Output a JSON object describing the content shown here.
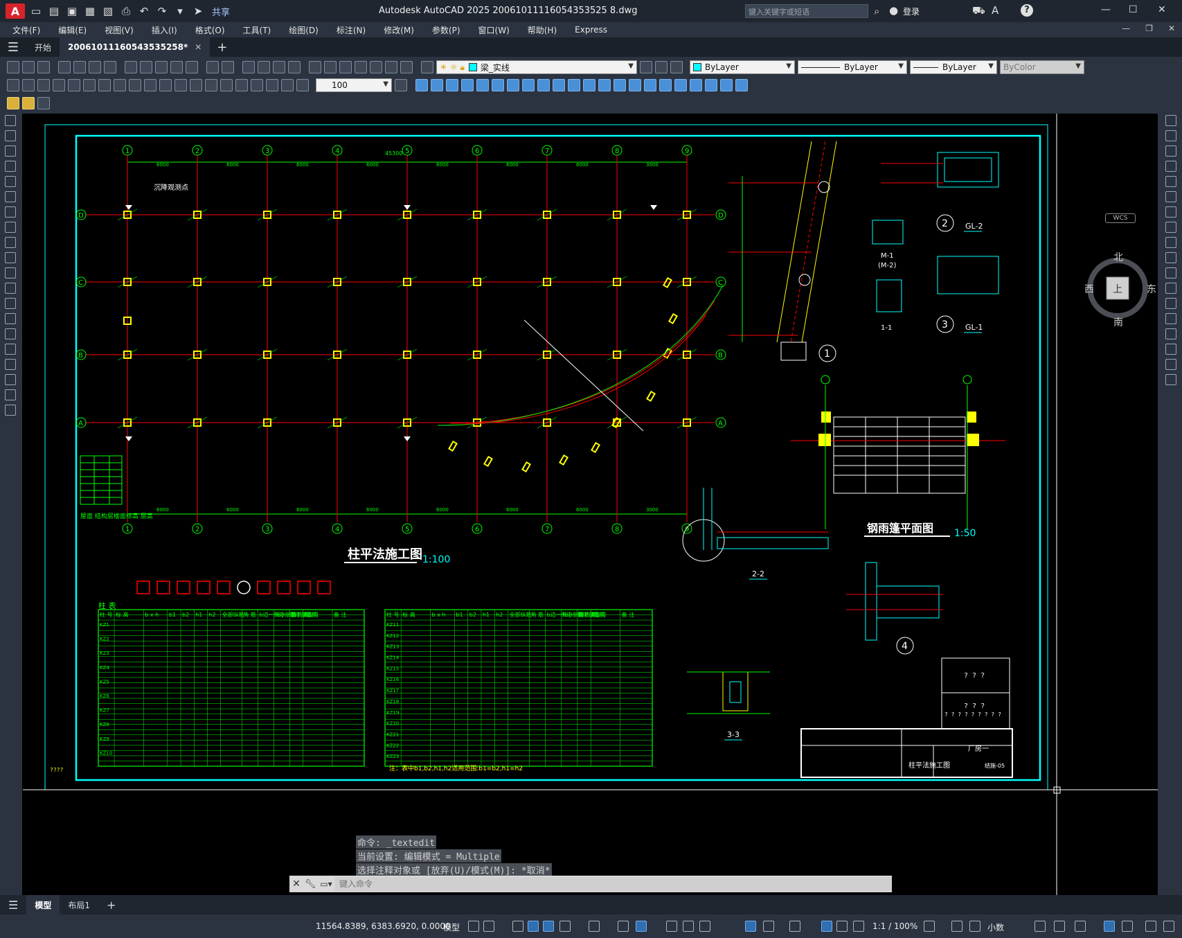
{
  "titlebar": {
    "app_logo": "A",
    "share_label": "共享",
    "title": "Autodesk AutoCAD 2025    20061011116054353525 8.dwg",
    "search_placeholder": "键入关键字或短语",
    "login_label": "登录"
  },
  "menu": [
    "文件(F)",
    "编辑(E)",
    "视图(V)",
    "插入(I)",
    "格式(O)",
    "工具(T)",
    "绘图(D)",
    "标注(N)",
    "修改(M)",
    "参数(P)",
    "窗口(W)",
    "帮助(H)",
    "Express"
  ],
  "tabs": {
    "start": "开始",
    "active_doc": "20061011160543535258*"
  },
  "toolbar2": {
    "layer_name": "梁_实线",
    "color_value": "ByLayer",
    "linetype_value": "ByLayer",
    "lineweight_value": "ByLayer",
    "plotstyle_value": "ByColor"
  },
  "toolbar3": {
    "dim_scale": "100"
  },
  "viewcube": {
    "north": "北",
    "south": "南",
    "east": "东",
    "west": "西",
    "top": "上",
    "wcs": "WCS"
  },
  "drawing": {
    "grid_cols": [
      "1",
      "2",
      "3",
      "4",
      "5",
      "6",
      "7",
      "8",
      "9"
    ],
    "grid_rows": [
      "D",
      "C",
      "B",
      "A"
    ],
    "top_dim_total": "45300",
    "bay_dims": [
      "6000",
      "6000",
      "6000",
      "6000",
      "6000",
      "6000",
      "6000",
      "3000"
    ],
    "main_title": "柱平法施工图",
    "main_scale": "1:100",
    "canopy_title": "钢雨篷平面图",
    "canopy_scale": "1:50",
    "section_2": "2-2",
    "section_3": "3-3",
    "section_1": "1-1",
    "gl2": "GL-2",
    "gl1": "GL-1",
    "m1": "M-1",
    "m2": "(M-2)",
    "settle_note": "沉降观测点",
    "table_heading": "柱 表",
    "table_headers": [
      "柱 号",
      "标 高",
      "b x h",
      "b1",
      "b2",
      "h1",
      "h2",
      "全部纵筋",
      "角 筋",
      "b边一侧中部筋",
      "h边一侧中部筋",
      "箍筋类型号",
      "箍 筋",
      "备 注"
    ],
    "table_left_ids": [
      "KZ1",
      "KZ2",
      "KZ3",
      "KZ4",
      "KZ5",
      "KZ6",
      "KZ7",
      "KZ8",
      "KZ9",
      "KZ10"
    ],
    "table_right_ids": [
      "KZ11",
      "KZ12",
      "KZ13",
      "KZ14",
      "KZ15",
      "KZ16",
      "KZ17",
      "KZ18",
      "KZ19",
      "KZ20",
      "KZ21",
      "KZ22",
      "KZ23"
    ],
    "footnote": "注：表中b1,b2,h1,h2适用范围:b1=b2,h1=h2",
    "titleblock_project": "厂房一",
    "titleblock_sheet": "柱平法施工图",
    "titleblock_no": "结施-05",
    "titleblock_q1": "? ? ?",
    "titleblock_q2": "? ? ? ? ? ? ? ? ?",
    "floor_table_title": "屋面  结构层楼面标高  层高",
    "left_qmarks": "????"
  },
  "command": {
    "history": [
      "命令: _textedit",
      "当前设置: 编辑模式 = Multiple",
      "选择注释对象或 [放弃(U)/模式(M)]: *取消*"
    ],
    "placeholder": "键入命令"
  },
  "layout_tabs": {
    "model": "模型",
    "layout1": "布局1"
  },
  "status": {
    "coords": "11564.8389, 6383.6920, 0.0000",
    "model": "模型",
    "scale": "1:1 / 100%",
    "units": "小数"
  },
  "colors": {
    "cyan": "#00ffff",
    "green": "#00ff00",
    "red": "#ff0000",
    "yellow": "#ffff00",
    "white": "#ffffff"
  }
}
